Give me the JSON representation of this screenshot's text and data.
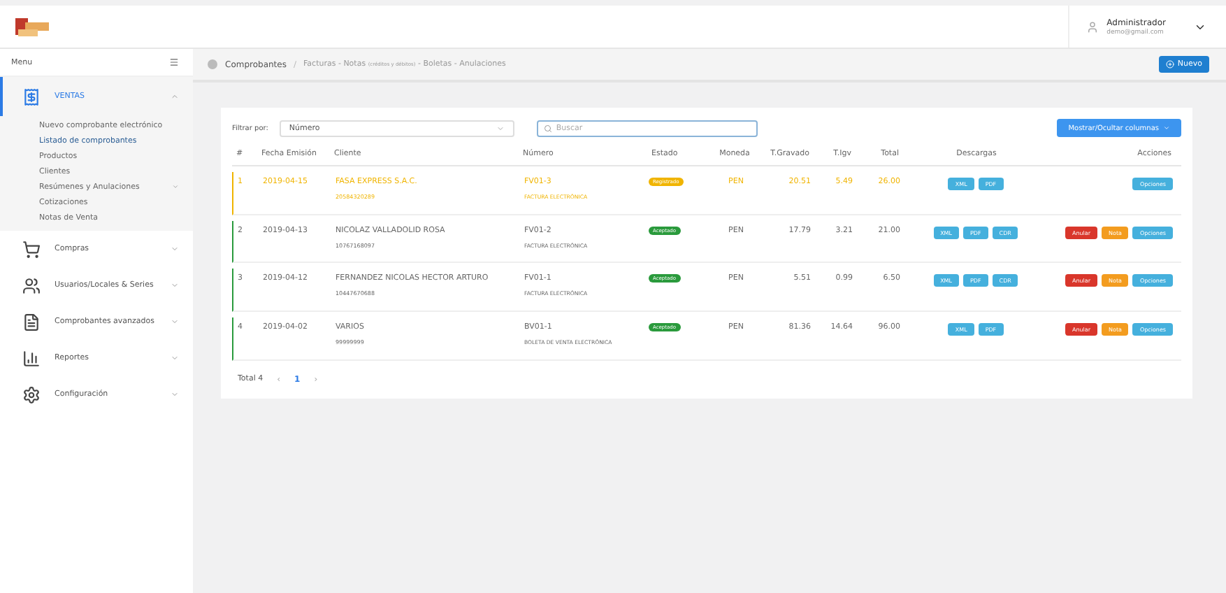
{
  "user": {
    "name": "Administrador",
    "email": "demo@gmail.com"
  },
  "sidebar": {
    "title": "Menu",
    "items": [
      {
        "label": "VENTAS",
        "expanded": true,
        "selected": true,
        "children": [
          {
            "label": "Nuevo comprobante electrónico",
            "selected": false
          },
          {
            "label": "Listado de comprobantes",
            "selected": true
          },
          {
            "label": "Productos",
            "selected": false
          },
          {
            "label": "Clientes",
            "selected": false
          },
          {
            "label": "Resúmenes y Anulaciones",
            "selected": false,
            "has_children": true
          },
          {
            "label": "Cotizaciones",
            "selected": false
          },
          {
            "label": "Notas de Venta",
            "selected": false
          }
        ]
      },
      {
        "label": "Compras",
        "expanded": false,
        "selected": false
      },
      {
        "label": "Usuarios/Locales & Series",
        "expanded": false,
        "selected": false
      },
      {
        "label": "Comprobantes avanzados",
        "expanded": false,
        "selected": false
      },
      {
        "label": "Reportes",
        "expanded": false,
        "selected": false
      },
      {
        "label": "Configuración",
        "expanded": false,
        "selected": false
      }
    ]
  },
  "breadcrumb": {
    "title": "Comprobantes",
    "separator": "/",
    "path_start": "Facturas - Notas",
    "path_small": "(créditos y débitos)",
    "path_end": "- Boletas - Anulaciones"
  },
  "new_button": "Nuevo",
  "filter": {
    "label": "Filtrar por:",
    "value": "Número",
    "search_placeholder": "Buscar",
    "columns_button": "Mostrar/Ocultar columnas"
  },
  "table": {
    "columns": [
      "#",
      "Fecha Emisión",
      "Cliente",
      "Número",
      "Estado",
      "Moneda",
      "T.Gravado",
      "T.Igv",
      "Total",
      "Descargas",
      "Acciones"
    ],
    "rows": [
      {
        "index": "1",
        "date": "2019-04-15",
        "client": "FASA EXPRESS S.A.C.",
        "doc": "20584320289",
        "number": "FV01-3",
        "type": "FACTURA ELECTRÓNICA",
        "status": "Registrado",
        "kind": "pending",
        "currency": "PEN",
        "taxable": "20.51",
        "igv": "5.49",
        "total": "26.00",
        "downloads": [
          "XML",
          "PDF"
        ],
        "actions": [
          {
            "label": "Opciones",
            "kind": "info"
          }
        ]
      },
      {
        "index": "2",
        "date": "2019-04-13",
        "client": "NICOLAZ VALLADOLID ROSA",
        "doc": "10767168097",
        "number": "FV01-2",
        "type": "FACTURA ELECTRÓNICA",
        "status": "Aceptado",
        "kind": "accepted",
        "currency": "PEN",
        "taxable": "17.79",
        "igv": "3.21",
        "total": "21.00",
        "downloads": [
          "XML",
          "PDF",
          "CDR"
        ],
        "actions": [
          {
            "label": "Anular",
            "kind": "danger"
          },
          {
            "label": "Nota",
            "kind": "warning"
          },
          {
            "label": "Opciones",
            "kind": "info"
          }
        ]
      },
      {
        "index": "3",
        "date": "2019-04-12",
        "client": "FERNANDEZ NICOLAS HECTOR ARTURO",
        "doc": "10447670688",
        "number": "FV01-1",
        "type": "FACTURA ELECTRÓNICA",
        "status": "Aceptado",
        "kind": "accepted",
        "currency": "PEN",
        "taxable": "5.51",
        "igv": "0.99",
        "total": "6.50",
        "downloads": [
          "XML",
          "PDF",
          "CDR"
        ],
        "actions": [
          {
            "label": "Anular",
            "kind": "danger"
          },
          {
            "label": "Nota",
            "kind": "warning"
          },
          {
            "label": "Opciones",
            "kind": "info"
          }
        ]
      },
      {
        "index": "4",
        "date": "2019-04-02",
        "client": "VARIOS",
        "doc": "99999999",
        "number": "BV01-1",
        "type": "BOLETA DE VENTA ELECTRÓNICA",
        "status": "Aceptado",
        "kind": "accepted",
        "currency": "PEN",
        "taxable": "81.36",
        "igv": "14.64",
        "total": "96.00",
        "downloads": [
          "XML",
          "PDF"
        ],
        "actions": [
          {
            "label": "Anular",
            "kind": "danger"
          },
          {
            "label": "Nota",
            "kind": "warning"
          },
          {
            "label": "Opciones",
            "kind": "info"
          }
        ]
      }
    ]
  },
  "pagination": {
    "total": "Total 4",
    "prev": "‹",
    "next": "›",
    "pages": [
      {
        "label": "1",
        "selected": true
      }
    ]
  }
}
